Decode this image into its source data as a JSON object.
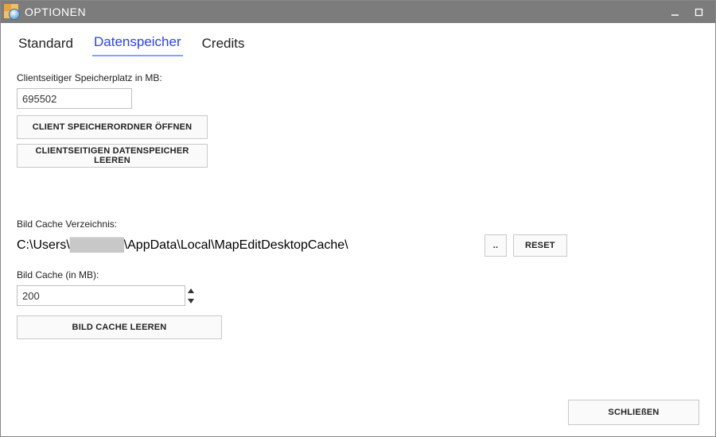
{
  "window": {
    "title": "OPTIONEN"
  },
  "tabs": {
    "standard": "Standard",
    "datenspeicher": "Datenspeicher",
    "credits": "Credits"
  },
  "clientStorage": {
    "label": "Clientseitiger Speicherplatz in MB:",
    "value": "695502",
    "openFolderBtn": "CLIENT SPEICHERORDNER ÖFFNEN",
    "clearBtn": "CLIENTSEITIGEN DATENSPEICHER LEEREN"
  },
  "imageCache": {
    "dirLabel": "Bild Cache Verzeichnis:",
    "dirPrefix": "C:\\Users\\",
    "dirRedacted": "██████",
    "dirSuffix": "\\AppData\\Local\\MapEditDesktopCache\\",
    "browseBtn": "..",
    "resetBtn": "RESET",
    "sizeLabel": "Bild Cache (in MB):",
    "sizeValue": "200",
    "clearBtn": "BILD CACHE LEEREN"
  },
  "footer": {
    "closeBtn": "SCHLIEßEN"
  }
}
